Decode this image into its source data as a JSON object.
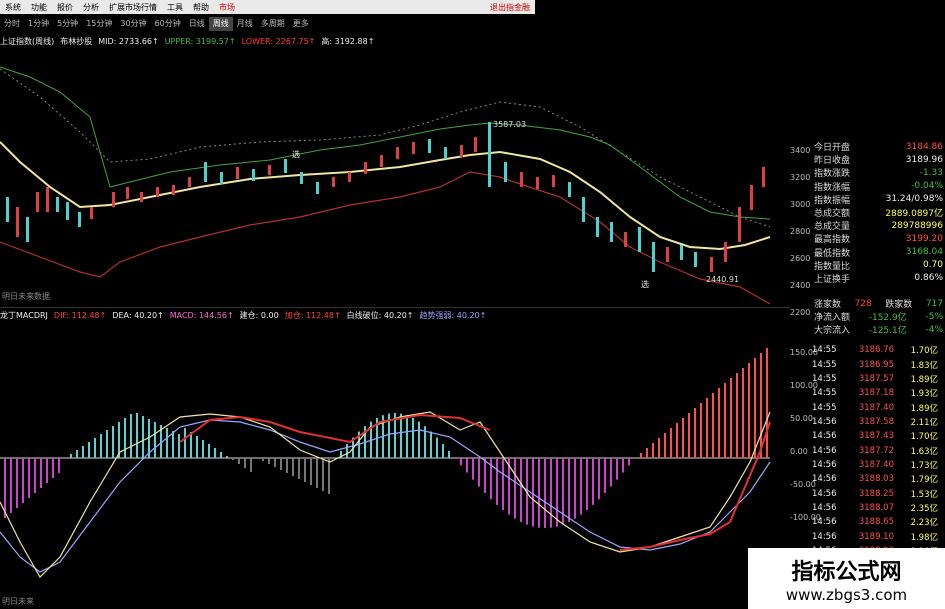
{
  "menu": {
    "items": [
      "系统",
      "功能",
      "报价",
      "分析",
      "扩展市场行情",
      "工具",
      "帮助",
      "市场"
    ],
    "right": "退出指金融"
  },
  "periods": {
    "items": [
      "分时",
      "1分钟",
      "5分钟",
      "15分钟",
      "30分钟",
      "60分钟",
      "日线",
      "周线",
      "月线",
      "多周期",
      "更多"
    ],
    "active": 7
  },
  "infobar": {
    "title": "上证指数(周线)",
    "ind": "布林抄股",
    "mid": "MID: 2733.66↑",
    "upper": "UPPER: 3199.57↑",
    "lower": "LOWER: 2267.75↑",
    "high": "高: 3192.88↑"
  },
  "main_annotations": {
    "peak": "3587.03",
    "low": "2440.91",
    "flag1": "选",
    "flag2": "选",
    "future": "明日未来数据"
  },
  "y_axis_main": [
    "3400",
    "3200",
    "3000",
    "2800",
    "2600",
    "2400",
    "2200"
  ],
  "macd_info": {
    "name": "龙丁MACDRJ",
    "dif": "DIF: 112.48↑",
    "dea": "DEA: 40.20↑",
    "macd": "MACD: 144.56↑",
    "build": "建仓: 0.00",
    "add": "加仓: 112.48↑",
    "white": "白线破位: 40.20↑",
    "purple": "趋势强弱: 40.20↑"
  },
  "y_axis_macd": [
    "150.00",
    "100.00",
    "50.00",
    "0.00",
    "-50.00",
    "-100.00"
  ],
  "macd_note": "明日未来",
  "quote_panel": [
    {
      "label": "今日开盘",
      "value": "3184.86",
      "color": "#ff5050"
    },
    {
      "label": "昨日收盘",
      "value": "3189.96",
      "color": "#eeeeee"
    },
    {
      "label": "指数涨跌",
      "value": "-1.33",
      "color": "#3fbf3f"
    },
    {
      "label": "指数涨幅",
      "value": "-0.04%",
      "color": "#3fbf3f"
    },
    {
      "label": "指数振幅",
      "value": "31.24/0.98%",
      "color": "#eeeeee"
    },
    {
      "label": "总成交额",
      "value": "2889.0897亿",
      "color": "#ffff55"
    },
    {
      "label": "总成交量",
      "value": "289788996",
      "color": "#ffff55"
    },
    {
      "label": "最高指数",
      "value": "3199.20",
      "color": "#ff5050"
    },
    {
      "label": "最低指数",
      "value": "3168.04",
      "color": "#3fbf3f"
    },
    {
      "label": "指数量比",
      "value": "0.70",
      "color": "#ffff55"
    },
    {
      "label": "上证换手",
      "value": "0.86%",
      "color": "#eeeeee"
    }
  ],
  "flow": {
    "up_label": "涨家数",
    "up": "728",
    "down_label": "跌家数",
    "down": "717",
    "rows": [
      {
        "label": "净流入额",
        "value": "-152.9亿",
        "pct": "-5%"
      },
      {
        "label": "大宗流入",
        "value": "-125.1亿",
        "pct": "-4%"
      }
    ]
  },
  "ticks": [
    {
      "t": "14:55",
      "p": "3186.76",
      "v": "1.70亿"
    },
    {
      "t": "14:55",
      "p": "3186.95",
      "v": "1.83亿"
    },
    {
      "t": "14:55",
      "p": "3187.57",
      "v": "1.89亿"
    },
    {
      "t": "14:55",
      "p": "3187.18",
      "v": "1.93亿"
    },
    {
      "t": "14:55",
      "p": "3187.40",
      "v": "1.89亿"
    },
    {
      "t": "14:56",
      "p": "3187.58",
      "v": "2.11亿"
    },
    {
      "t": "14:56",
      "p": "3187.43",
      "v": "1.70亿"
    },
    {
      "t": "14:56",
      "p": "3187.72",
      "v": "1.63亿"
    },
    {
      "t": "14:56",
      "p": "3187.40",
      "v": "1.73亿"
    },
    {
      "t": "14:56",
      "p": "3188.03",
      "v": "1.79亿"
    },
    {
      "t": "14:56",
      "p": "3188.25",
      "v": "1.53亿"
    },
    {
      "t": "14:56",
      "p": "3188.07",
      "v": "2.35亿"
    },
    {
      "t": "14:56",
      "p": "3188.65",
      "v": "2.23亿"
    },
    {
      "t": "14:56",
      "p": "3189.10",
      "v": "1.98亿"
    },
    {
      "t": "14:56",
      "p": "3188.93",
      "v": "1.80亿"
    }
  ],
  "watermark": {
    "line1": "指标公式网",
    "line2": "www.zbgs3.com"
  }
}
